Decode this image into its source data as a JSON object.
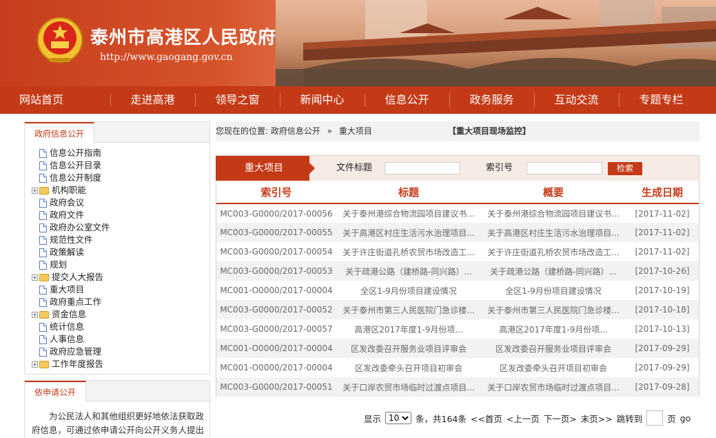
{
  "header": {
    "site_title": "泰州市高港区人民政府",
    "site_url": "http://www.gaogang.gov.cn"
  },
  "nav": [
    {
      "label": "网站首页"
    },
    {
      "label": "走进高港"
    },
    {
      "label": "领导之窗"
    },
    {
      "label": "新闻中心"
    },
    {
      "label": "信息公开"
    },
    {
      "label": "政务服务"
    },
    {
      "label": "互动交流"
    },
    {
      "label": "专题专栏"
    }
  ],
  "sidebar": {
    "tab_title": "政府信息公开",
    "tree": [
      {
        "label": "信息公开指南"
      },
      {
        "label": "信息公开目录"
      },
      {
        "label": "信息公开制度"
      },
      {
        "label": "机构职能"
      },
      {
        "label": "政府会议"
      },
      {
        "label": "政府文件"
      },
      {
        "label": "政府办公室文件"
      },
      {
        "label": "规范性文件"
      },
      {
        "label": "政策解读"
      },
      {
        "label": "规划"
      },
      {
        "label": "提交人大报告"
      },
      {
        "label": "重大项目"
      },
      {
        "label": "政府重点工作"
      },
      {
        "label": "资金信息"
      },
      {
        "label": "统计信息"
      },
      {
        "label": "人事信息"
      },
      {
        "label": "政府应急管理"
      },
      {
        "label": "工作年度报告"
      }
    ],
    "apply_tab": "依申请公开",
    "apply_text": "为公民法人和其他组织更好地依法获取政府信息，可通过依申请公开向公开义务人提出"
  },
  "breadcrumb": {
    "prefix": "您现在的位置:",
    "level1": "政府信息公开",
    "sep": "»",
    "level2": "重大项目",
    "monitor_link": "【重大项目现场监控】"
  },
  "panel": {
    "tab_label": "重大项目",
    "title_label": "文件标题",
    "title_value": "",
    "index_label": "索引号",
    "index_value": "",
    "search_button": "检索"
  },
  "table": {
    "headers": [
      "索引号",
      "标题",
      "概要",
      "生成日期"
    ],
    "rows": [
      [
        "MC003-G0000/2017-00056",
        "关于泰州港综合物流园项目建议书...",
        "关于泰州港综合物流园项目建议书...",
        "[2017-11-02]"
      ],
      [
        "MC003-G0000/2017-00055",
        "关于高港区村庄生活污水治理项目...",
        "关于高港区村庄生活污水治理项目...",
        "[2017-11-02]"
      ],
      [
        "MC003-G0000/2017-00054",
        "关于许庄街道孔桥农贸市场改造工...",
        "关于许庄街道孔桥农贸市场改造工...",
        "[2017-11-02]"
      ],
      [
        "MC003-G0000/2017-00053",
        "关于疏港公路（建桥路-同兴路）...",
        "关于疏港公路（建桥路-同兴路）...",
        "[2017-10-26]"
      ],
      [
        "MC001-O0000/2017-00004",
        "全区1-9月份项目建设情况",
        "全区1-9月份项目建设情况",
        "[2017-10-19]"
      ],
      [
        "MC003-G0000/2017-00052",
        "关于泰州市第三人民医院门急诊楼...",
        "关于泰州市第三人民医院门急诊楼...",
        "[2017-10-18]"
      ],
      [
        "MC003-G0000/2017-00057",
        "高港区2017年度1-9月份项...",
        "高港区2017年度1-9月份项...",
        "[2017-10-13]"
      ],
      [
        "MC001-O0000/2017-00004",
        "区发改委召开服务业项目评审会",
        "区发改委召开服务业项目评审会",
        "[2017-09-29]"
      ],
      [
        "MC001-O0000/2017-00004",
        "区发改委牵头召开项目初审会",
        "区发改委牵头召开项目初审会",
        "[2017-09-29]"
      ],
      [
        "MC003-G0000/2017-00051",
        "关于口岸农贸市场临时过渡点项目...",
        "关于口岸农贸市场临时过渡点项目...",
        "[2017-09-28]"
      ]
    ]
  },
  "pager": {
    "show_label": "显示",
    "page_size": "10",
    "count_text": "条，共164条",
    "first": "<<首页",
    "prev": "<上一页",
    "next": "下一页>",
    "last": "末页>>",
    "jump_label": "跳转到",
    "page_unit": "页",
    "go": "go"
  }
}
